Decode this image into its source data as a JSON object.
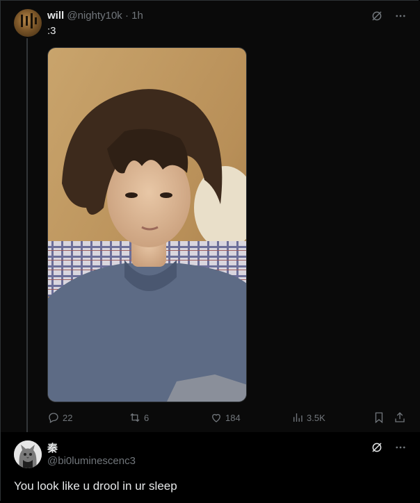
{
  "tweet": {
    "name": "will",
    "handle": "@nighty10k",
    "separator": "·",
    "time": "1h",
    "text": ":3",
    "icons": [
      "grok-icon",
      "more-icon"
    ],
    "stats": {
      "replies": "22",
      "reposts": "6",
      "likes": "184",
      "views": "3.5K"
    }
  },
  "reply": {
    "name": "秦",
    "handle": "@bi0luminescenc3",
    "text": "You look like u drool in ur sleep",
    "icons": [
      "grok-icon",
      "more-icon"
    ]
  },
  "colors": {
    "background": "#000000",
    "text": "#e7e9ea",
    "muted": "#71767b",
    "border": "#2f3336"
  }
}
